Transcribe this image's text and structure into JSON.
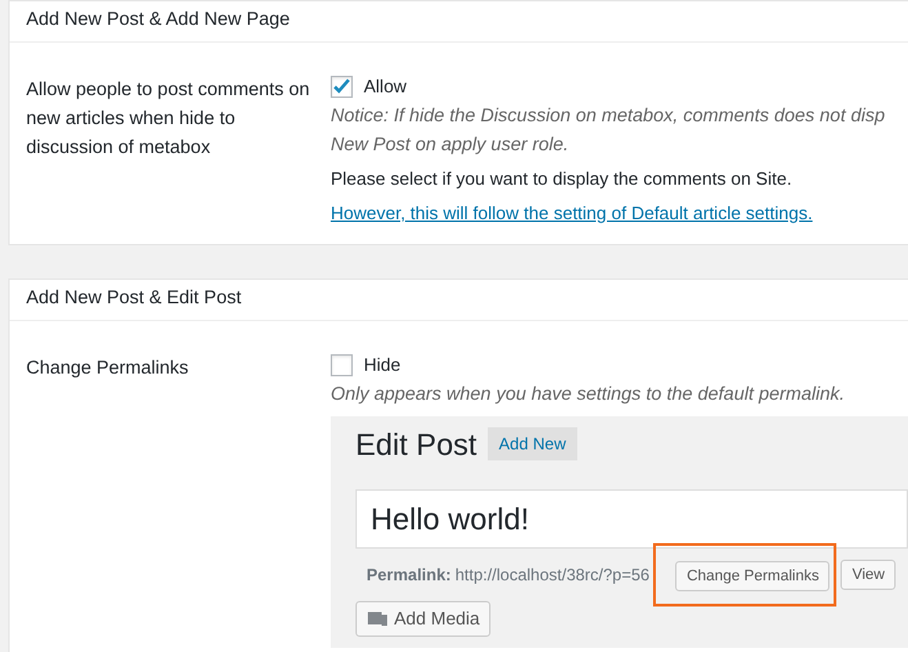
{
  "sections": [
    {
      "title": "Add New Post & Add New Page",
      "label": "Allow people to post comments on new articles when hide to discussion of metabox",
      "checkbox": {
        "label": "Allow",
        "checked": true
      },
      "notes": [
        {
          "kind": "notice",
          "text": "Notice: If hide the Discussion on metabox, comments does not disp"
        },
        {
          "kind": "notice",
          "text": "New Post on apply user role."
        },
        {
          "kind": "text",
          "text": "Please select if you want to display the comments on Site."
        },
        {
          "kind": "link",
          "text": "However, this will follow the setting of Default article settings."
        }
      ]
    },
    {
      "title": "Add New Post & Edit Post",
      "label": "Change Permalinks",
      "checkbox": {
        "label": "Hide",
        "checked": false
      },
      "notes": [
        {
          "kind": "notice",
          "text": "Only appears when you have settings to the default permalink."
        }
      ],
      "preview": {
        "heading": "Edit Post",
        "add_new": "Add New",
        "title_value": "Hello world!",
        "permalink_label": "Permalink:",
        "permalink_url": "http://localhost/38rc/?p=56",
        "buttons": [
          {
            "label": "Change Permalinks",
            "highlighted": true
          },
          {
            "label": "View",
            "highlighted": false
          }
        ],
        "add_media": "Add Media"
      }
    }
  ]
}
